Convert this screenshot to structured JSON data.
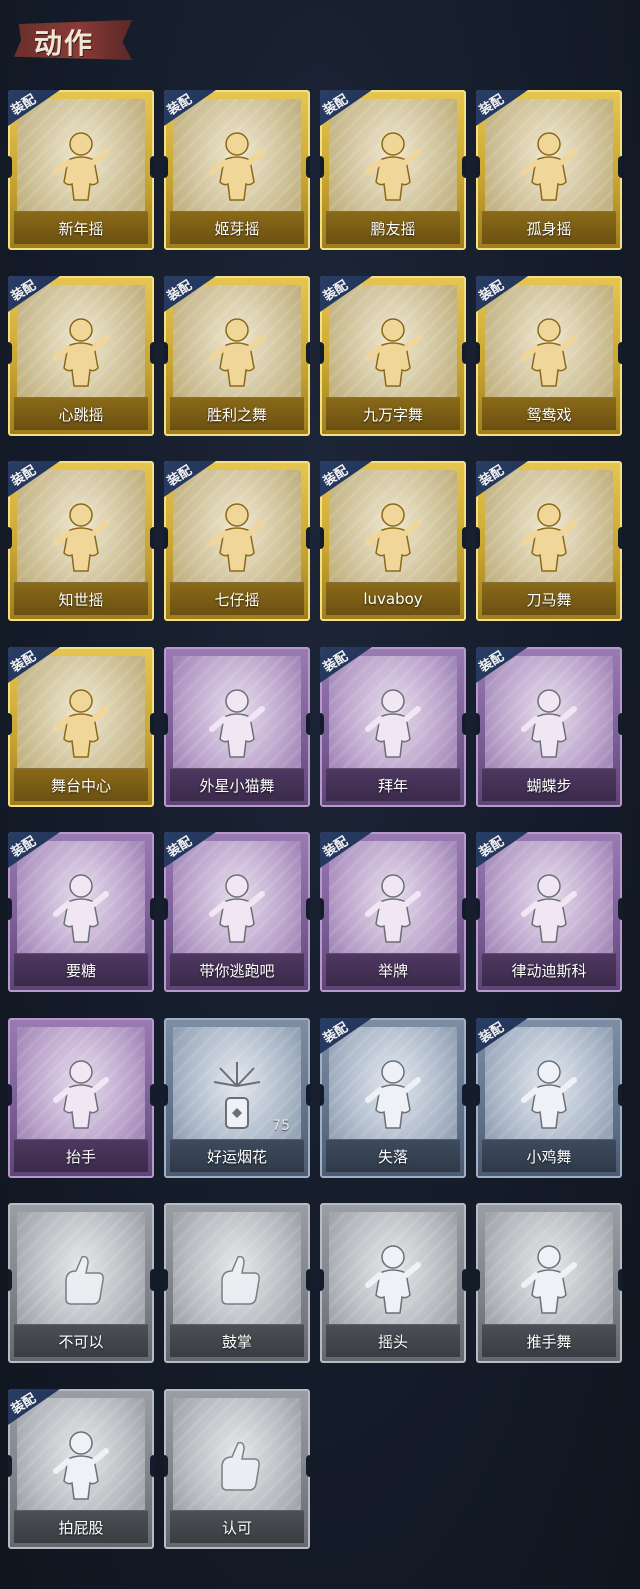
{
  "header": {
    "title": "动作"
  },
  "colors": {
    "gold": "#d9b840",
    "purple": "#8d6ea6",
    "blue": "#6d7e96",
    "gray": "#8a8e95",
    "background": "#141c2b",
    "badge": "#24375c"
  },
  "badge_label": "装配",
  "items": [
    {
      "name": "新年摇",
      "rarity": "gold",
      "equipped": true,
      "icon": "dancer-figure-icon"
    },
    {
      "name": "姬芽摇",
      "rarity": "gold",
      "equipped": true,
      "icon": "dancer-figure-icon"
    },
    {
      "name": "鹏友摇",
      "rarity": "gold",
      "equipped": true,
      "icon": "dancer-figure-icon"
    },
    {
      "name": "孤身摇",
      "rarity": "gold",
      "equipped": true,
      "icon": "dancer-figure-icon"
    },
    {
      "name": "心跳摇",
      "rarity": "gold",
      "equipped": true,
      "icon": "dancer-figure-icon"
    },
    {
      "name": "胜利之舞",
      "rarity": "gold",
      "equipped": true,
      "icon": "dancer-figure-icon"
    },
    {
      "name": "九万字舞",
      "rarity": "gold",
      "equipped": true,
      "icon": "dancer-figure-icon"
    },
    {
      "name": "鸳鸯戏",
      "rarity": "gold",
      "equipped": true,
      "icon": "dancer-figure-icon"
    },
    {
      "name": "知世摇",
      "rarity": "gold",
      "equipped": true,
      "icon": "dancer-figure-icon"
    },
    {
      "name": "七仔摇",
      "rarity": "gold",
      "equipped": true,
      "icon": "dancer-figure-icon"
    },
    {
      "name": "luvaboy",
      "rarity": "gold",
      "equipped": true,
      "icon": "dancer-figure-icon"
    },
    {
      "name": "刀马舞",
      "rarity": "gold",
      "equipped": true,
      "icon": "dancer-figure-icon"
    },
    {
      "name": "舞台中心",
      "rarity": "gold",
      "equipped": true,
      "icon": "dancer-figure-icon"
    },
    {
      "name": "外星小猫舞",
      "rarity": "purple",
      "equipped": false,
      "icon": "dancer-figure-icon"
    },
    {
      "name": "拜年",
      "rarity": "purple",
      "equipped": true,
      "icon": "bowing-figure-icon"
    },
    {
      "name": "蝴蝶步",
      "rarity": "purple",
      "equipped": true,
      "icon": "dancer-figure-icon"
    },
    {
      "name": "要糖",
      "rarity": "purple",
      "equipped": true,
      "icon": "reaching-figure-icon"
    },
    {
      "name": "带你逃跑吧",
      "rarity": "purple",
      "equipped": true,
      "icon": "dancer-figure-icon"
    },
    {
      "name": "举牌",
      "rarity": "purple",
      "equipped": true,
      "icon": "sign-holding-figure-icon"
    },
    {
      "name": "律动迪斯科",
      "rarity": "purple",
      "equipped": true,
      "icon": "disco-figure-icon"
    },
    {
      "name": "抬手",
      "rarity": "purple",
      "equipped": false,
      "icon": "raising-hand-figure-icon"
    },
    {
      "name": "好运烟花",
      "rarity": "blue",
      "equipped": false,
      "icon": "firework-icon",
      "count": "75"
    },
    {
      "name": "失落",
      "rarity": "blue",
      "equipped": true,
      "icon": "crawling-figure-icon"
    },
    {
      "name": "小鸡舞",
      "rarity": "blue",
      "equipped": true,
      "icon": "chicken-dance-figure-icon"
    },
    {
      "name": "不可以",
      "rarity": "gray",
      "equipped": false,
      "icon": "pointing-hand-icon"
    },
    {
      "name": "鼓掌",
      "rarity": "gray",
      "equipped": false,
      "icon": "clapping-hands-icon"
    },
    {
      "name": "摇头",
      "rarity": "gray",
      "equipped": false,
      "icon": "head-shake-figure-icon"
    },
    {
      "name": "推手舞",
      "rarity": "gray",
      "equipped": false,
      "icon": "push-hands-figure-icon"
    },
    {
      "name": "拍屁股",
      "rarity": "gray",
      "equipped": true,
      "icon": "butt-pat-figure-icon"
    },
    {
      "name": "认可",
      "rarity": "gray",
      "equipped": false,
      "icon": "thumbs-up-icon"
    }
  ]
}
